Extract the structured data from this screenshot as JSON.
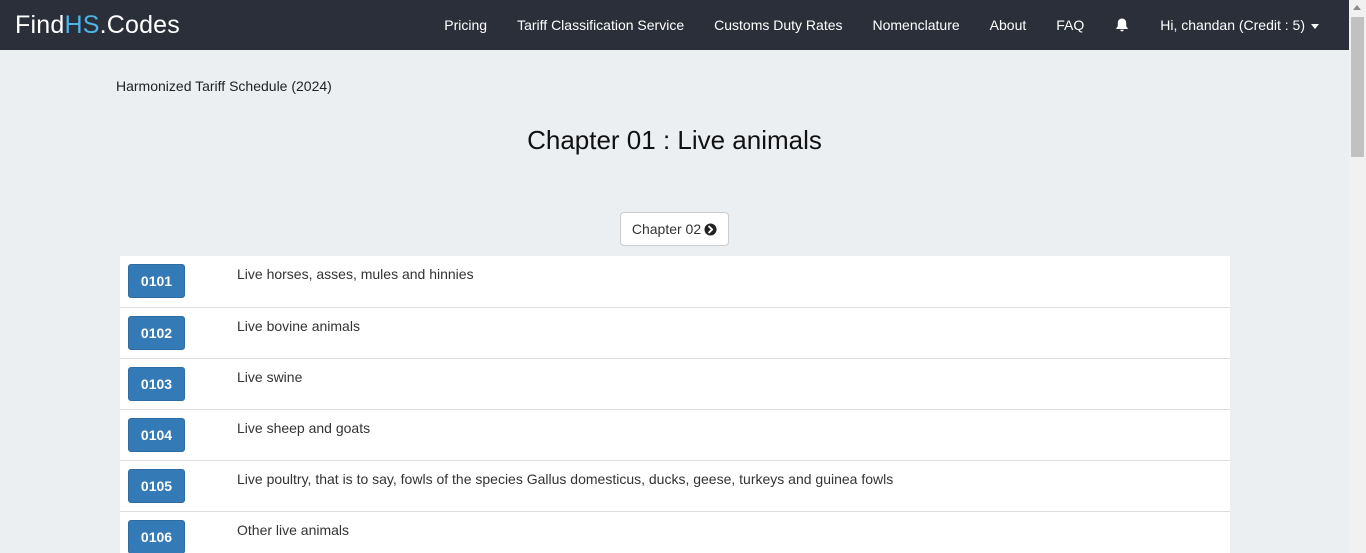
{
  "brand": {
    "part1": "Find",
    "part2": "HS",
    "part3": ".Codes"
  },
  "nav": {
    "items": [
      "Pricing",
      "Tariff Classification Service",
      "Customs Duty Rates",
      "Nomenclature",
      "About",
      "FAQ"
    ],
    "user_label": "Hi, chandan (Credit : 5)"
  },
  "breadcrumb": "Harmonized Tariff Schedule (2024)",
  "title": "Chapter 01 : Live animals",
  "next_chapter_label": "Chapter 02",
  "headings": [
    {
      "code": "0101",
      "description": "Live horses, asses, mules and hinnies"
    },
    {
      "code": "0102",
      "description": "Live bovine animals"
    },
    {
      "code": "0103",
      "description": "Live swine"
    },
    {
      "code": "0104",
      "description": "Live sheep and goats"
    },
    {
      "code": "0105",
      "description": "Live poultry, that is to say, fowls of the species Gallus domesticus, ducks, geese, turkeys and guinea fowls"
    },
    {
      "code": "0106",
      "description": "Other live animals"
    }
  ],
  "colors": {
    "navbar": "#2b2f3a",
    "brand_accent": "#4db3e8",
    "code_button": "#337ab7",
    "page_bg": "#eceff2"
  }
}
